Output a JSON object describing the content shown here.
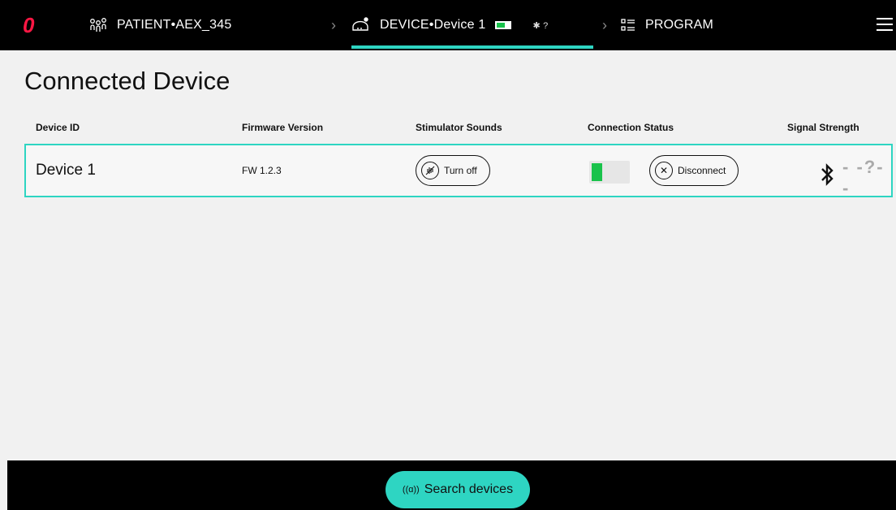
{
  "nav": {
    "patient_label": "PATIENT",
    "patient_sep": " • ",
    "patient_id": "AEX_345",
    "device_label": "DEVICE",
    "device_sep": " • ",
    "device_name": "Device 1",
    "program_label": "PROGRAM",
    "signal_unknown": "?"
  },
  "page": {
    "title": "Connected Device"
  },
  "table": {
    "headers": {
      "device_id": "Device ID",
      "firmware": "Firmware Version",
      "sounds": "Stimulator Sounds",
      "connection": "Connection Status",
      "signal": "Signal Strength"
    },
    "rows": [
      {
        "device_id": "Device 1",
        "firmware": "FW 1.2.3",
        "sounds_button": "Turn off",
        "disconnect_button": "Disconnect",
        "battery_level": 0.3,
        "signal": "?"
      }
    ]
  },
  "footer": {
    "search_button": "Search devices"
  },
  "colors": {
    "accent": "#2ed5c2",
    "battery_green": "#19c24b",
    "logo": "#ff1744"
  }
}
